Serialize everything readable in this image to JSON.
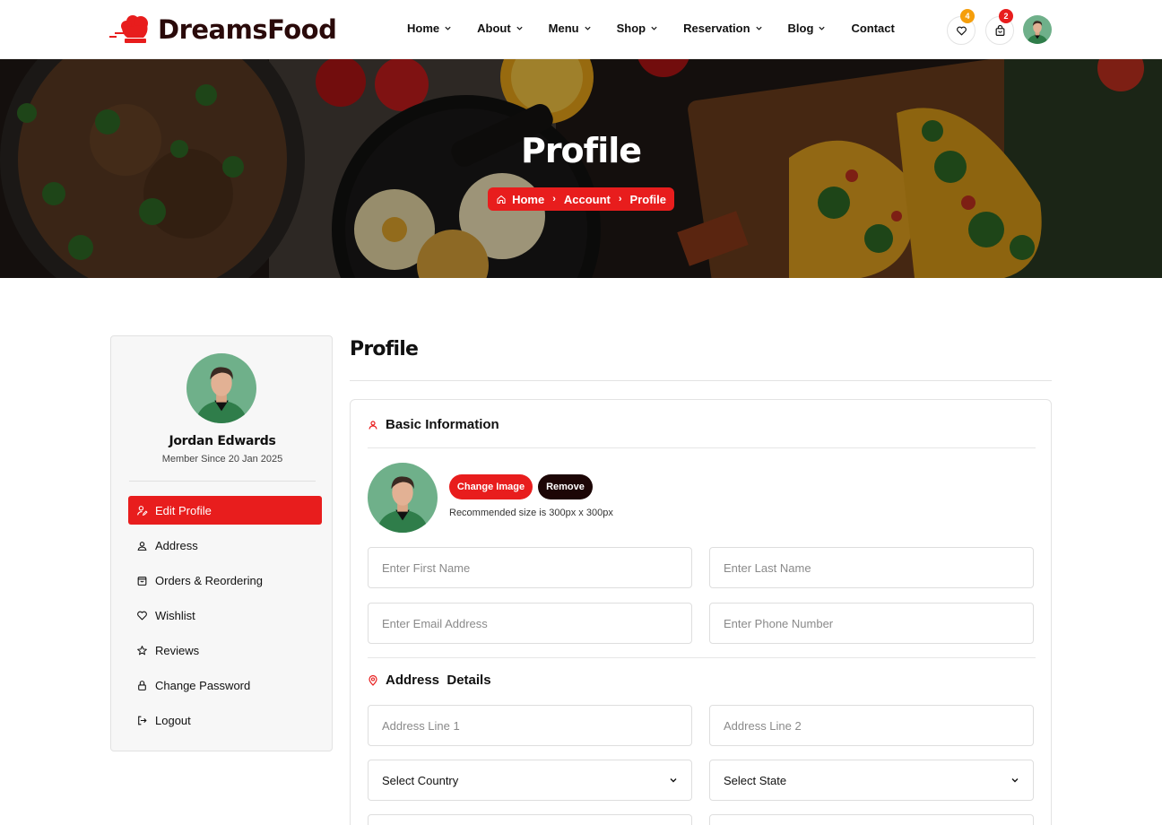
{
  "header": {
    "logo_text": "DreamsFood",
    "nav": [
      {
        "label": "Home",
        "dropdown": true
      },
      {
        "label": "About",
        "dropdown": true
      },
      {
        "label": "Menu",
        "dropdown": true
      },
      {
        "label": "Shop",
        "dropdown": true
      },
      {
        "label": "Reservation",
        "dropdown": true
      },
      {
        "label": "Blog",
        "dropdown": true
      },
      {
        "label": "Contact",
        "dropdown": false
      }
    ],
    "wishlist_count": "4",
    "cart_count": "2",
    "colors": {
      "accent": "#e81d1d",
      "wishlist_badge": "#f59e0b",
      "cart_badge": "#e81d1d"
    }
  },
  "hero": {
    "title": "Profile",
    "breadcrumb": [
      "Home",
      "Account",
      "Profile"
    ]
  },
  "sidebar": {
    "name": "Jordan Edwards",
    "member_since": "Member Since 20 Jan 2025",
    "items": [
      {
        "label": "Edit Profile",
        "icon": "user-edit-icon",
        "active": true
      },
      {
        "label": "Address",
        "icon": "address-icon",
        "active": false
      },
      {
        "label": "Orders & Reordering",
        "icon": "orders-icon",
        "active": false
      },
      {
        "label": "Wishlist",
        "icon": "heart-icon",
        "active": false
      },
      {
        "label": "Reviews",
        "icon": "star-icon",
        "active": false
      },
      {
        "label": "Change Password",
        "icon": "lock-icon",
        "active": false
      },
      {
        "label": "Logout",
        "icon": "logout-icon",
        "active": false
      }
    ]
  },
  "main": {
    "title": "Profile",
    "basic": {
      "title": "Basic Information",
      "change_image": "Change Image",
      "remove": "Remove",
      "recommended": "Recommended size is 300px x 300px",
      "first_name_placeholder": "Enter First Name",
      "last_name_placeholder": "Enter Last Name",
      "email_placeholder": "Enter Email Address",
      "phone_placeholder": "Enter Phone Number"
    },
    "address": {
      "title": "Address  Details",
      "line1_placeholder": "Address Line 1",
      "line2_placeholder": "Address Line 2",
      "country": "Select Country",
      "state": "Select State"
    }
  }
}
